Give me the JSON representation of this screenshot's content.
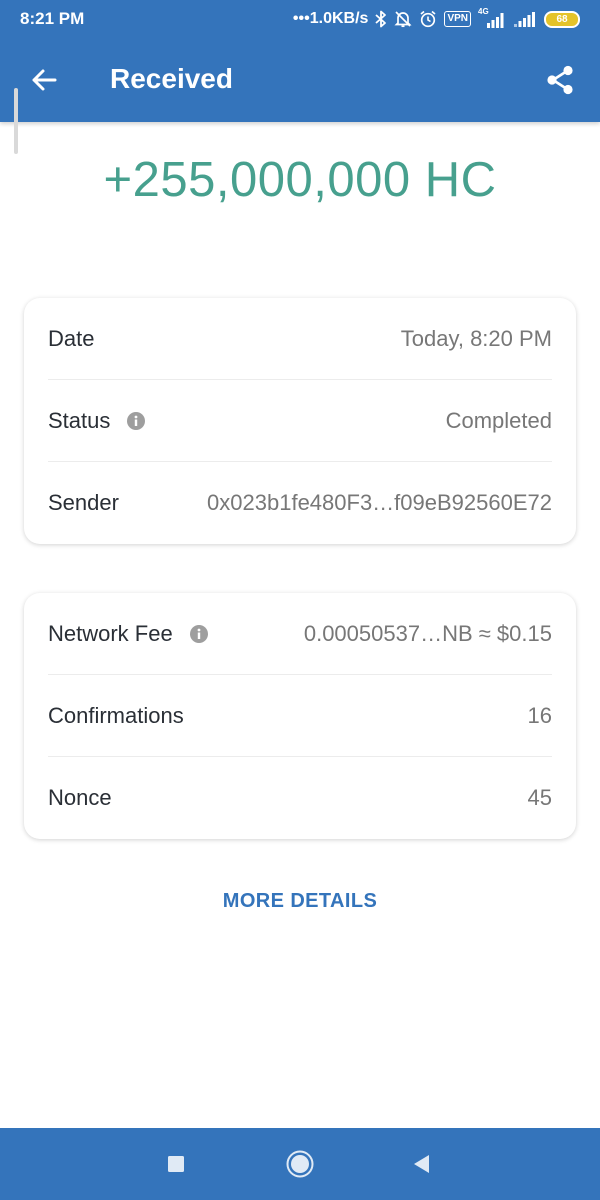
{
  "status_bar": {
    "time": "8:21 PM",
    "network_speed": "1.0KB/s",
    "vpn_label": "VPN",
    "network_type": "4G",
    "battery_level": "68"
  },
  "app_bar": {
    "title": "Received"
  },
  "transaction": {
    "amount": "+255,000,000 HC"
  },
  "details_card": {
    "rows": [
      {
        "label": "Date",
        "value": "Today, 8:20 PM",
        "has_info": false
      },
      {
        "label": "Status",
        "value": "Completed",
        "has_info": true
      },
      {
        "label": "Sender",
        "value": "0x023b1fe480F3…f09eB92560E72",
        "has_info": false
      }
    ]
  },
  "network_card": {
    "rows": [
      {
        "label": "Network Fee",
        "value": "0.00050537…NB ≈ $0.15",
        "has_info": true
      },
      {
        "label": "Confirmations",
        "value": "16",
        "has_info": false
      },
      {
        "label": "Nonce",
        "value": "45",
        "has_info": false
      }
    ]
  },
  "more_details_label": "MORE DETAILS",
  "colors": {
    "primary": "#3474bb",
    "amount_green": "#47a08e",
    "label_text": "#2a2f36",
    "value_text": "#777777",
    "battery": "#e4c32a"
  },
  "icons": {
    "back": "arrow-left-icon",
    "share": "share-icon",
    "info": "info-icon",
    "nav_recents": "square-icon",
    "nav_home": "circle-icon",
    "nav_back": "triangle-left-icon"
  }
}
